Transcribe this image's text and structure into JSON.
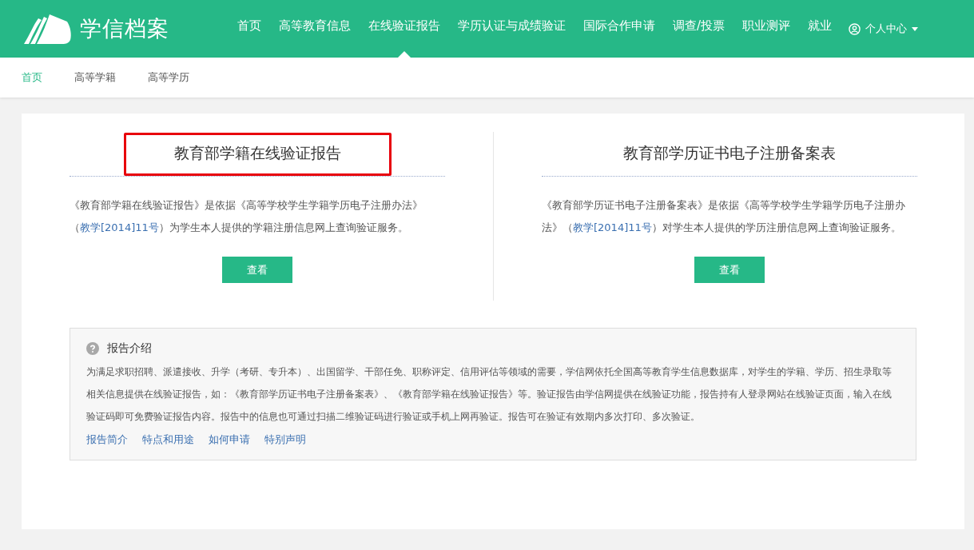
{
  "header": {
    "logo_text": "学信档案",
    "nav": [
      {
        "label": "首页",
        "selected": false
      },
      {
        "label": "高等教育信息",
        "selected": false
      },
      {
        "label": "在线验证报告",
        "selected": true
      },
      {
        "label": "学历认证与成绩验证",
        "selected": false
      },
      {
        "label": "国际合作申请",
        "selected": false
      },
      {
        "label": "调查/投票",
        "selected": false
      },
      {
        "label": "职业测评",
        "selected": false
      },
      {
        "label": "就业",
        "selected": false
      }
    ],
    "user_menu": "个人中心"
  },
  "subnav": [
    {
      "label": "首页",
      "selected": true
    },
    {
      "label": "高等学籍",
      "selected": false
    },
    {
      "label": "高等学历",
      "selected": false
    }
  ],
  "reports": [
    {
      "title": "教育部学籍在线验证报告",
      "highlighted": true,
      "description": {
        "before": "《教育部学籍在线验证报告》是依据《高等学校学生学籍学历电子注册办法》（",
        "link": "教学[2014]11号",
        "after": "）为学生本人提供的学籍注册信息网上查询验证服务。"
      },
      "button": "查看"
    },
    {
      "title": "教育部学历证书电子注册备案表",
      "highlighted": false,
      "description": {
        "before": "《教育部学历证书电子注册备案表》是依据《高等学校学生学籍学历电子注册办法》（",
        "link": "教学[2014]11号",
        "after": "）对学生本人提供的学历注册信息网上查询验证服务。"
      },
      "button": "查看"
    }
  ],
  "intro": {
    "title": "报告介绍",
    "text": "为满足求职招聘、派遣接收、升学（考研、专升本）、出国留学、干部任免、职称评定、信用评估等领域的需要，学信网依托全国高等教育学生信息数据库，对学生的学籍、学历、招生录取等相关信息提供在线验证报告，如：《教育部学历证书电子注册备案表》、《教育部学籍在线验证报告》等。验证报告由学信网提供在线验证功能，报告持有人登录网站在线验证页面，输入在线验证码即可免费验证报告内容。报告中的信息也可通过扫描二维验证码进行验证或手机上网再验证。报告可在验证有效期内多次打印、多次验证。",
    "links": [
      "报告简介",
      "特点和用途",
      "如何申请",
      "特别声明"
    ]
  }
}
